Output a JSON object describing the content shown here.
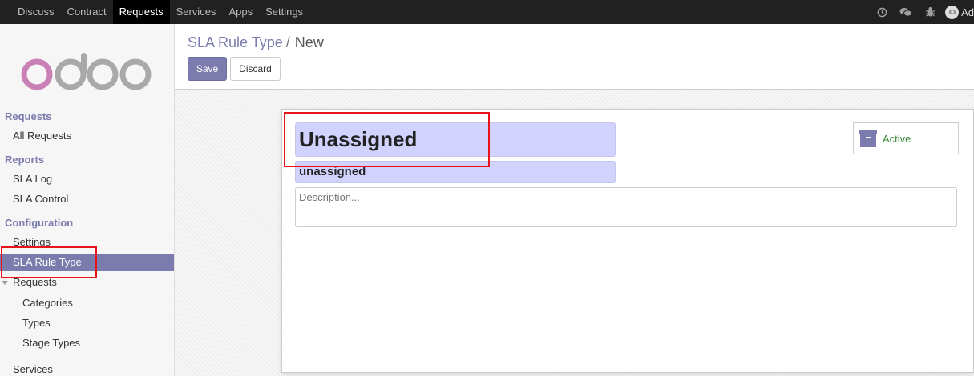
{
  "topbar": {
    "menu": [
      {
        "label": "Discuss",
        "active": false
      },
      {
        "label": "Contract",
        "active": false
      },
      {
        "label": "Requests",
        "active": true
      },
      {
        "label": "Services",
        "active": false
      },
      {
        "label": "Apps",
        "active": false
      },
      {
        "label": "Settings",
        "active": false
      }
    ],
    "icons": [
      "clock-icon",
      "chat-icon",
      "bug-icon"
    ],
    "user_label": "Ad"
  },
  "sidebar": {
    "logo_text": "odoo",
    "items": [
      {
        "label": "Requests",
        "kind": "head"
      },
      {
        "label": "All Requests",
        "kind": "l1"
      },
      {
        "label": "Reports",
        "kind": "head"
      },
      {
        "label": "SLA Log",
        "kind": "l1"
      },
      {
        "label": "SLA Control",
        "kind": "l1"
      },
      {
        "label": "Configuration",
        "kind": "head"
      },
      {
        "label": "Settings",
        "kind": "l1"
      },
      {
        "label": "SLA Rule Type",
        "kind": "l1",
        "active": true
      },
      {
        "label": "Requests",
        "kind": "l1",
        "caret": true
      },
      {
        "label": "Categories",
        "kind": "l2"
      },
      {
        "label": "Types",
        "kind": "l2"
      },
      {
        "label": "Stage Types",
        "kind": "l2"
      },
      {
        "label": "Services",
        "kind": "l1"
      }
    ]
  },
  "control": {
    "breadcrumb_link": "SLA Rule Type",
    "breadcrumb_sep": "/",
    "breadcrumb_current": "New",
    "save_label": "Save",
    "discard_label": "Discard"
  },
  "form": {
    "name_value": "Unassigned",
    "code_value": "unassigned",
    "description_placeholder": "Description...",
    "active_label": "Active"
  },
  "colors": {
    "accent": "#7c7bad",
    "active_green": "#3c8a3c",
    "required_field": "#d2d2ff",
    "annotation_red": "#e8141a"
  }
}
